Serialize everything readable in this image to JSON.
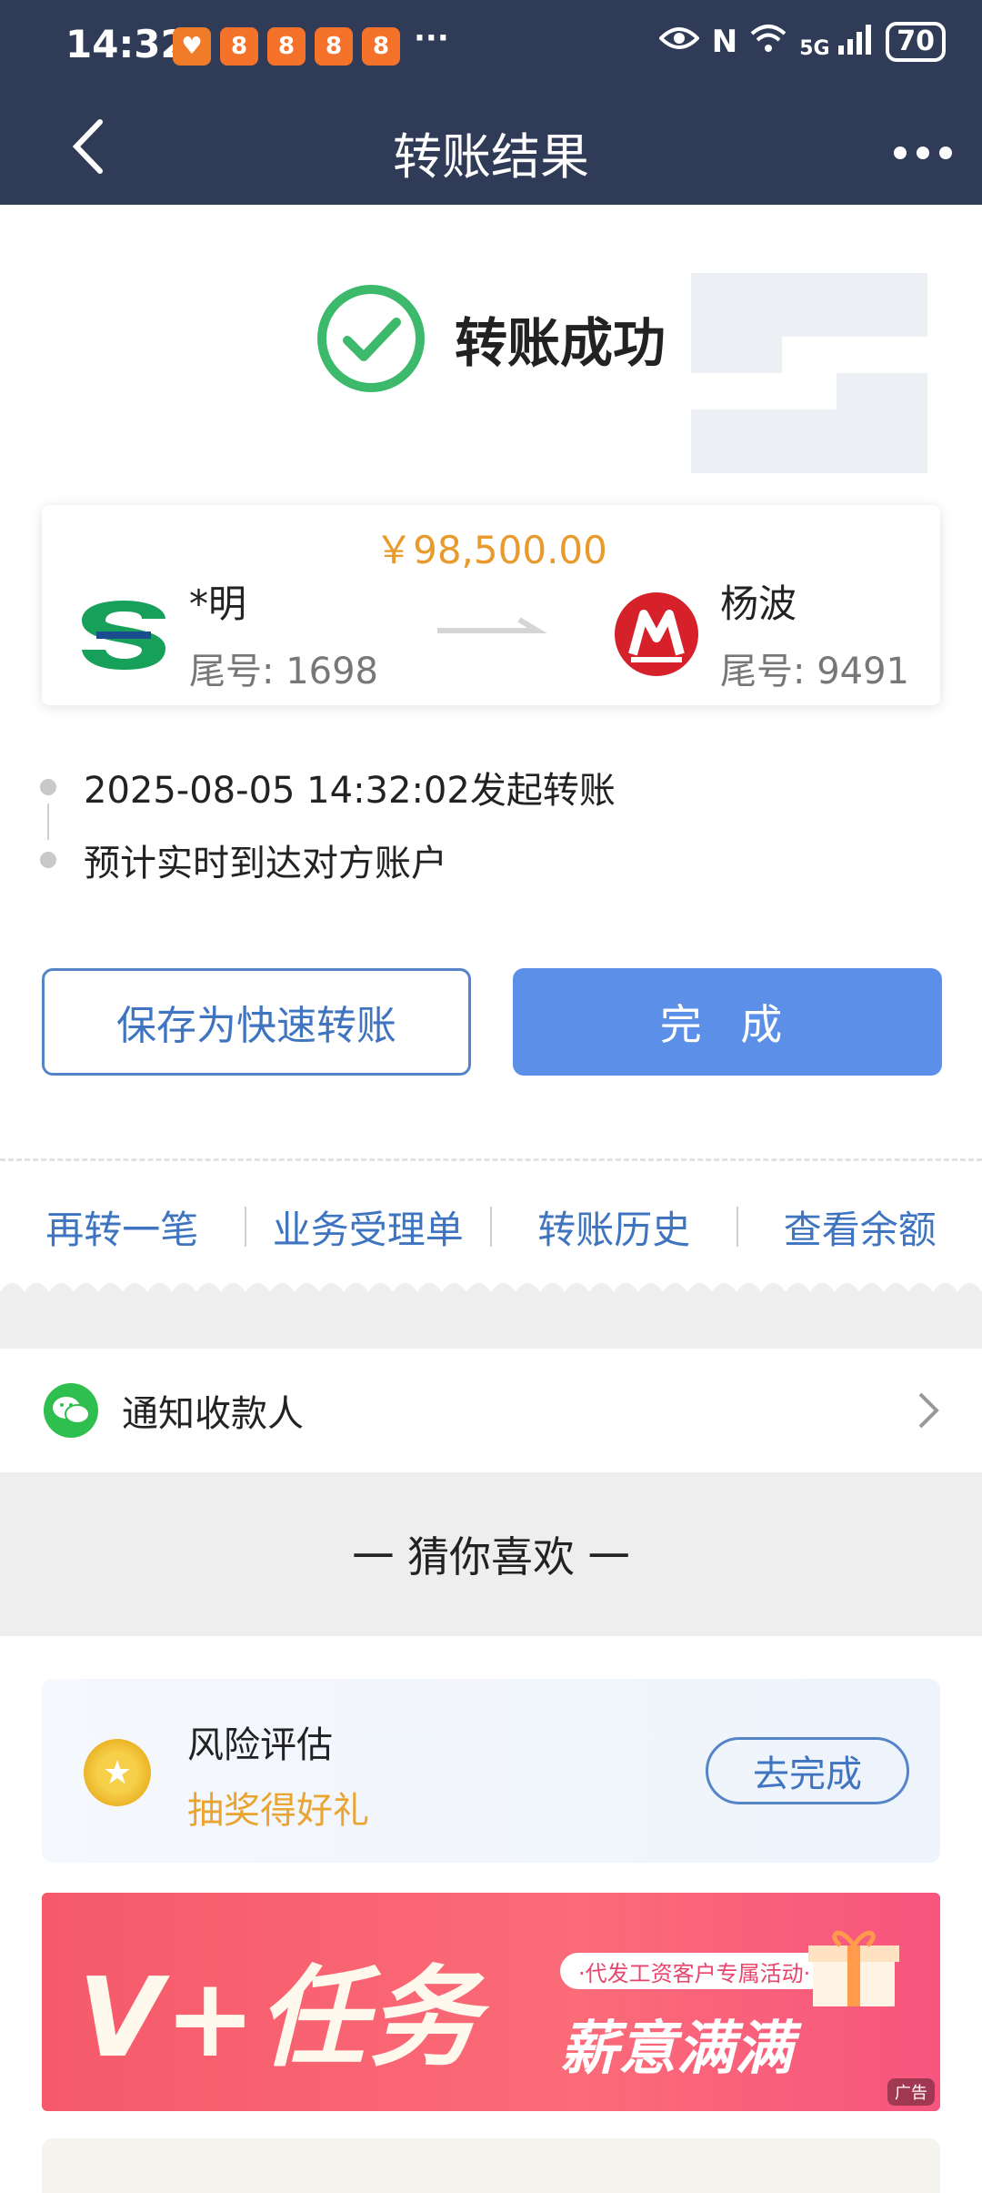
{
  "status_bar": {
    "time": "14:32",
    "more": "···",
    "battery": "70",
    "signal": "5G"
  },
  "header": {
    "title": "转账结果"
  },
  "result": {
    "status_text": "转账成功"
  },
  "transfer": {
    "amount": "￥98,500.00",
    "from": {
      "name": "*明",
      "tail": "尾号: 1698"
    },
    "to": {
      "name": "杨波",
      "tail": "尾号: 9491"
    }
  },
  "timeline": [
    {
      "text": "2025-08-05 14:32:02发起转账"
    },
    {
      "text": "预计实时到达对方账户"
    }
  ],
  "buttons": {
    "save_quick": "保存为快速转账",
    "done": "完 成"
  },
  "quick_links": [
    "再转一笔",
    "业务受理单",
    "转账历史",
    "查看余额"
  ],
  "notify": {
    "label": "通知收款人"
  },
  "recommend": {
    "title": "一 猜你喜欢 一"
  },
  "risk": {
    "title": "风险评估",
    "subtitle": "抽奖得好礼",
    "button": "去完成"
  },
  "banner": {
    "main": "V+任务",
    "tag": "·代发工资客户专属活动·",
    "sub": "薪意满满",
    "ad": "广告"
  },
  "colors": {
    "header_bg": "#2f3b57",
    "primary": "#5b8fe8",
    "link": "#3f74c0",
    "success": "#3cb96a",
    "amount": "#e99a2c"
  }
}
